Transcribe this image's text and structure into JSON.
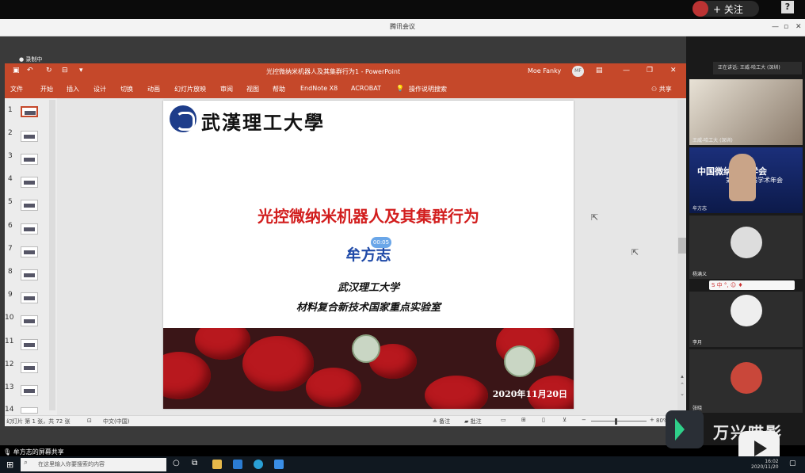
{
  "topbar": {
    "follow_label": "+ 关注",
    "help_label": "?"
  },
  "meeting": {
    "title": "腾讯会议",
    "recording_label": "录制中"
  },
  "ppt": {
    "window_title": "光控微纳米机器人及其集群行为1  -  PowerPoint",
    "user_name": "Moe Fanky",
    "user_initials": "MF",
    "tabs": [
      "文件",
      "开始",
      "插入",
      "设计",
      "切换",
      "动画",
      "幻灯片放映",
      "审阅",
      "视图",
      "帮助",
      "EndNote X8",
      "ACROBAT",
      "操作说明搜索"
    ],
    "share_label": "共享",
    "thumb_numbers": [
      "1",
      "2",
      "3",
      "4",
      "5",
      "6",
      "7",
      "8",
      "9",
      "10",
      "11",
      "12",
      "13",
      "14"
    ]
  },
  "slide": {
    "university_name": "武漢理工大學",
    "title": "光控微纳米机器人及其集群行为",
    "presenter": "牟方志",
    "badge": "00:05",
    "institution_1": "武汉理工大学",
    "institution_2": "材料复合新技术国家重点实验室",
    "date": "2020年11月20日"
  },
  "statusbar": {
    "slide_count": "幻灯片 第 1 张，共 72 张",
    "language": "中文(中国)",
    "notes": "备注",
    "comments": "批注",
    "zoom": "80%"
  },
  "participants": {
    "speaking": "正在讲话: 王威-哈工大 (深圳)",
    "tiles": [
      {
        "name": "王威-哈工大 (深圳)"
      },
      {
        "name": "牟方志",
        "banner": "中国微纳技术学会",
        "sub": "第二十二届学术年会"
      },
      {
        "name": "杨满义"
      },
      {
        "name": "李月"
      },
      {
        "name": "张晓"
      }
    ],
    "ime_bar": "S 中 °, ☺ ♦"
  },
  "share": {
    "label": "牟方志的屏幕共享"
  },
  "watermark": {
    "text": "万兴喵影"
  },
  "taskbar": {
    "search_placeholder": "在这里输入你要搜索的内容",
    "time": "16:02",
    "date": "2020/11/20"
  }
}
